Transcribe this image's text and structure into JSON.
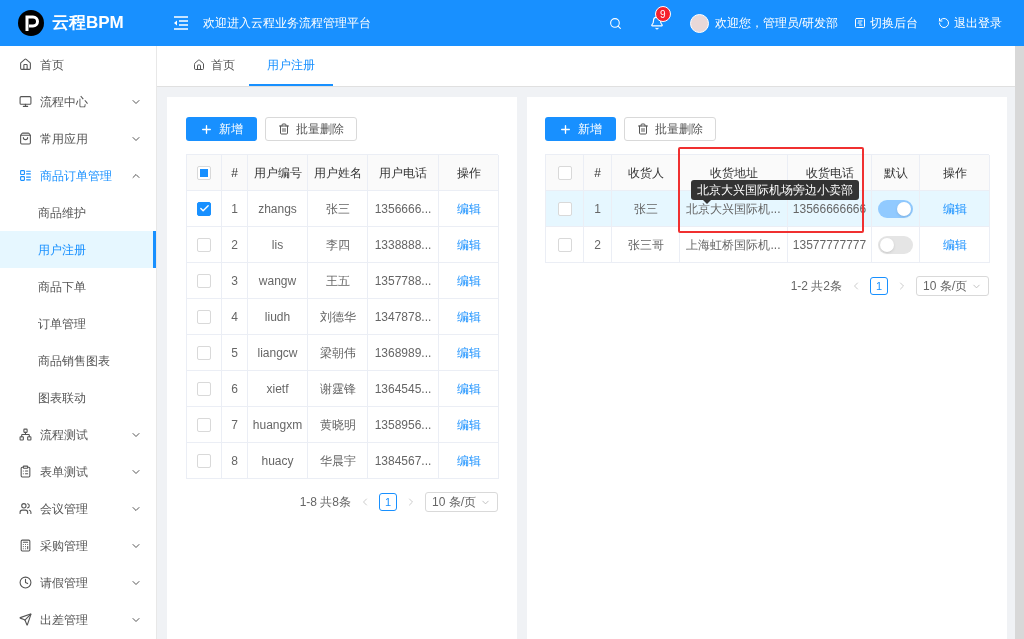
{
  "header": {
    "brand": "云程BPM",
    "subtitle": "欢迎进入云程业务流程管理平台",
    "notification_count": "9",
    "user": "欢迎您，管理员/研发部",
    "actions": [
      "切换后台",
      "退出登录"
    ]
  },
  "sidebar": {
    "items": [
      {
        "label": "首页",
        "selected": false
      },
      {
        "label": "流程中心",
        "selected": false,
        "expanded": false
      },
      {
        "label": "常用应用",
        "selected": false,
        "expanded": false
      },
      {
        "label": "商品订单管理",
        "selected": false,
        "expanded": true,
        "children": [
          {
            "label": "商品维护",
            "selected": false
          },
          {
            "label": "用户注册",
            "selected": true
          },
          {
            "label": "商品下单",
            "selected": false
          },
          {
            "label": "订单管理",
            "selected": false
          },
          {
            "label": "商品销售图表",
            "selected": false
          },
          {
            "label": "图表联动",
            "selected": false
          }
        ]
      },
      {
        "label": "流程测试",
        "selected": false,
        "expanded": false
      },
      {
        "label": "表单测试",
        "selected": false,
        "expanded": false
      },
      {
        "label": "会议管理",
        "selected": false,
        "expanded": false
      },
      {
        "label": "采购管理",
        "selected": false,
        "expanded": false
      },
      {
        "label": "请假管理",
        "selected": false,
        "expanded": false
      },
      {
        "label": "出差管理",
        "selected": false,
        "expanded": false
      }
    ]
  },
  "tabs": [
    {
      "label": "首页",
      "selected": false
    },
    {
      "label": "用户注册",
      "selected": true
    }
  ],
  "left_panel": {
    "buttons": [
      "新增",
      "批量删除"
    ],
    "table": {
      "all_checked": false,
      "indeterminate": true,
      "columns": [
        "#",
        "用户编号",
        "用户姓名",
        "用户电话",
        "操作"
      ],
      "rows": [
        {
          "checked": true,
          "cells": [
            "1",
            "zhangs",
            "张三",
            "1356666..."
          ],
          "action": "编辑"
        },
        {
          "checked": false,
          "cells": [
            "2",
            "lis",
            "李四",
            "1338888..."
          ],
          "action": "编辑"
        },
        {
          "checked": false,
          "cells": [
            "3",
            "wangw",
            "王五",
            "1357788..."
          ],
          "action": "编辑"
        },
        {
          "checked": false,
          "cells": [
            "4",
            "liudh",
            "刘德华",
            "1347878..."
          ],
          "action": "编辑"
        },
        {
          "checked": false,
          "cells": [
            "5",
            "liangcw",
            "梁朝伟",
            "1368989..."
          ],
          "action": "编辑"
        },
        {
          "checked": false,
          "cells": [
            "6",
            "xietf",
            "谢霆锋",
            "1364545..."
          ],
          "action": "编辑"
        },
        {
          "checked": false,
          "cells": [
            "7",
            "huangxm",
            "黄晓明",
            "1358956..."
          ],
          "action": "编辑"
        },
        {
          "checked": false,
          "cells": [
            "8",
            "huacy",
            "华晨宇",
            "1384567..."
          ],
          "action": "编辑"
        }
      ]
    },
    "pagination": {
      "summary": "1-8 共8条",
      "current": "1",
      "page_size": "10 条/页"
    }
  },
  "right_panel": {
    "buttons": [
      "新增",
      "批量删除"
    ],
    "table": {
      "all_checked": false,
      "columns": [
        "#",
        "收货人",
        "收货地址",
        "收货电话",
        "默认",
        "操作"
      ],
      "rows": [
        {
          "checked": false,
          "selected": true,
          "cells": [
            "1",
            "张三",
            "北京大兴国际机...",
            "13566666666"
          ],
          "default_on": true,
          "action": "编辑"
        },
        {
          "checked": false,
          "selected": false,
          "cells": [
            "2",
            "张三哥",
            "上海虹桥国际机...",
            "13577777777"
          ],
          "default_on": false,
          "action": "编辑"
        }
      ]
    },
    "tooltip": "北京大兴国际机场旁边小卖部",
    "pagination": {
      "summary": "1-2 共2条",
      "current": "1",
      "page_size": "10 条/页"
    }
  }
}
